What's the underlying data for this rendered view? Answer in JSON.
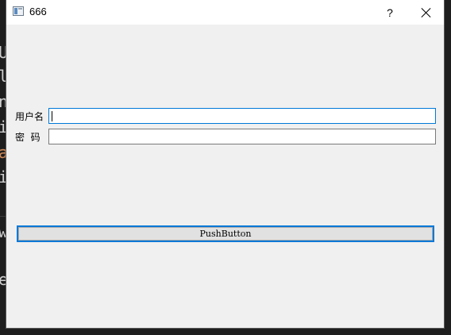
{
  "window": {
    "title": "666",
    "help_label": "?"
  },
  "form": {
    "username_label": "用户名",
    "username_value": "",
    "password_label": "密  码",
    "password_value": ""
  },
  "button": {
    "label": "PushButton"
  },
  "background_editor": {
    "glyphs": [
      "U",
      "l",
      "n",
      "i",
      "a",
      "i",
      "w",
      "e"
    ]
  },
  "colors": {
    "accent": "#0078d7",
    "window_bg": "#f0f0f0",
    "titlebar_bg": "#ffffff"
  }
}
